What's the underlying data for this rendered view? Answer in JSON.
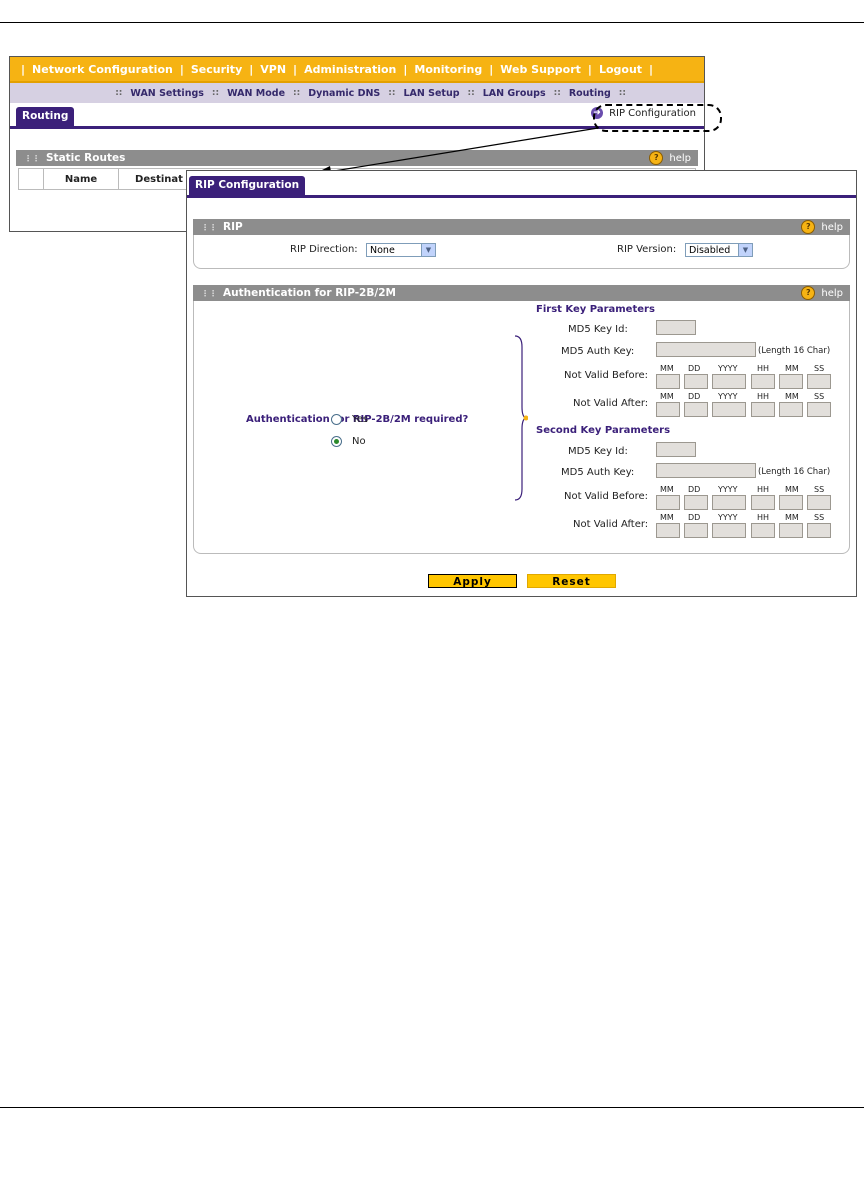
{
  "main_nav": [
    "Network Configuration",
    "Security",
    "VPN",
    "Administration",
    "Monitoring",
    "Web Support",
    "Logout"
  ],
  "sub_nav": [
    "WAN Settings",
    "WAN Mode",
    "Dynamic DNS",
    "LAN Setup",
    "LAN Groups",
    "Routing"
  ],
  "routing_tab": "Routing",
  "rip_link": "RIP Configuration",
  "static_routes": {
    "title": "Static Routes",
    "help": "help",
    "columns": [
      "Name",
      "Destinat"
    ]
  },
  "rip_window": {
    "tab": "RIP Configuration",
    "rip_section": {
      "title": "RIP",
      "help": "help",
      "direction_label": "RIP Direction:",
      "direction_value": "None",
      "version_label": "RIP Version:",
      "version_value": "Disabled"
    },
    "auth_section": {
      "title": "Authentication for RIP-2B/2M",
      "help": "help",
      "question": "Authentication for RIP-2B/2M required?",
      "option_yes": "Yes",
      "option_no": "No",
      "selected": "No",
      "first_key": {
        "heading": "First Key Parameters",
        "key_id_label": "MD5 Key Id:",
        "auth_key_label": "MD5 Auth Key:",
        "length_note": "(Length 16 Char)",
        "not_valid_before": "Not Valid Before:",
        "not_valid_after": "Not Valid After:"
      },
      "second_key": {
        "heading": "Second Key Parameters",
        "key_id_label": "MD5 Key Id:",
        "auth_key_label": "MD5 Auth Key:",
        "length_note": "(Length 16 Char)",
        "not_valid_before": "Not Valid Before:",
        "not_valid_after": "Not Valid After:"
      },
      "date_headers": [
        "MM",
        "DD",
        "YYYY",
        "HH",
        "MM",
        "SS"
      ]
    },
    "buttons": {
      "apply": "Apply",
      "reset": "Reset"
    }
  },
  "colors": {
    "nav_orange": "#f6b313",
    "tab_purple": "#3b207a",
    "section_gray": "#8d8d8d",
    "button_yellow": "#ffc600"
  }
}
